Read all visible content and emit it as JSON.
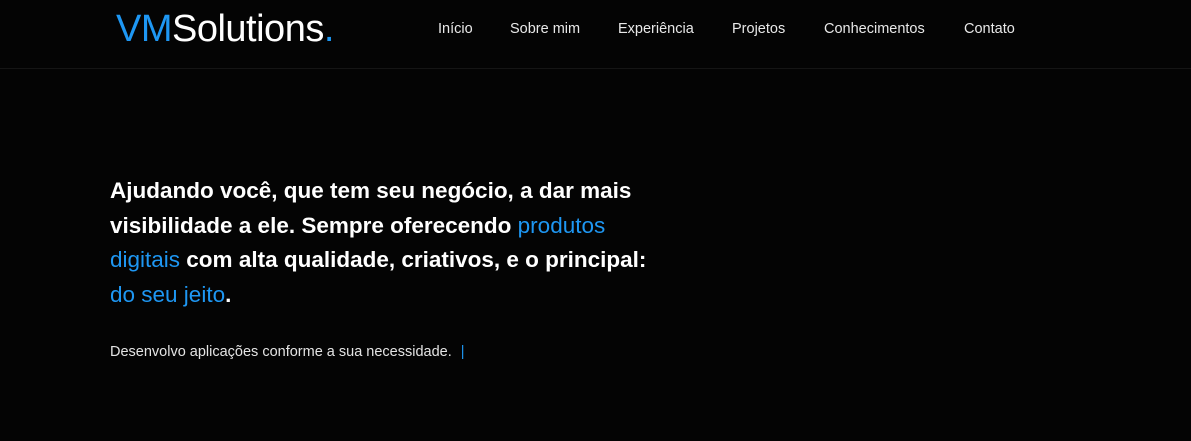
{
  "brand": {
    "part1": "VM",
    "part2": "Solutions",
    "part3": ".",
    "accent_color": "#1e97f3"
  },
  "nav": {
    "items": [
      {
        "label": "Início"
      },
      {
        "label": "Sobre mim"
      },
      {
        "label": "Experiência"
      },
      {
        "label": "Projetos"
      },
      {
        "label": "Conhecimentos"
      },
      {
        "label": "Contato"
      }
    ]
  },
  "hero": {
    "text_1": "Ajudando você, que tem seu negócio, a dar mais visibilidade a ele. Sempre oferecendo ",
    "highlight_1": "produtos digitais",
    "text_2": " com alta qualidade, criativos, e o principal: ",
    "highlight_2": "do seu jeito",
    "text_3": "."
  },
  "subtitle": {
    "text": "Desenvolvo aplicações conforme a sua necessidade.",
    "cursor": "|"
  }
}
